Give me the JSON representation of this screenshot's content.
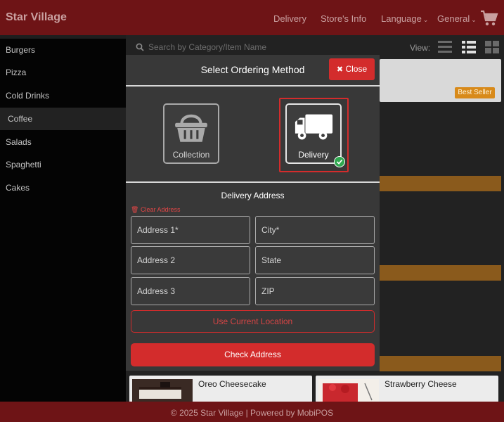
{
  "header": {
    "brand": "Star Village",
    "nav": [
      "Delivery",
      "Store's Info",
      "Language",
      "General"
    ],
    "cart_icon": "cart-icon"
  },
  "sidebar": {
    "items": [
      {
        "label": "Burgers",
        "active": false
      },
      {
        "label": "Pizza",
        "active": false
      },
      {
        "label": "Cold Drinks",
        "active": false
      },
      {
        "label": "Coffee",
        "active": true
      },
      {
        "label": "Salads",
        "active": false
      },
      {
        "label": "Spaghetti",
        "active": false
      },
      {
        "label": "Cakes",
        "active": false
      }
    ]
  },
  "toolbar": {
    "search_placeholder": "Search by Category/Item Name",
    "view_label": "View:"
  },
  "menu": {
    "best_seller_badge": "Best Seller",
    "bottom_items": [
      "Oreo Cheesecake",
      "Strawberry Cheese"
    ]
  },
  "modal": {
    "title": "Select Ordering Method",
    "close_label": "Close",
    "methods": [
      {
        "label": "Collection",
        "selected": false
      },
      {
        "label": "Delivery",
        "selected": true
      }
    ],
    "address_heading": "Delivery Address",
    "clear_label": "Clear Address",
    "fields": {
      "address1": "Address 1*",
      "city": "City*",
      "address2": "Address 2",
      "state": "State",
      "address3": "Address 3",
      "zip": "ZIP"
    },
    "use_location_label": "Use Current Location",
    "check_address_label": "Check Address"
  },
  "footer": {
    "text": "© 2025 Star Village | Powered by MobiPOS"
  },
  "colors": {
    "brand": "#6e1416",
    "accent": "#d32c2c",
    "success": "#2fa84f",
    "badge": "#d88a1a"
  }
}
